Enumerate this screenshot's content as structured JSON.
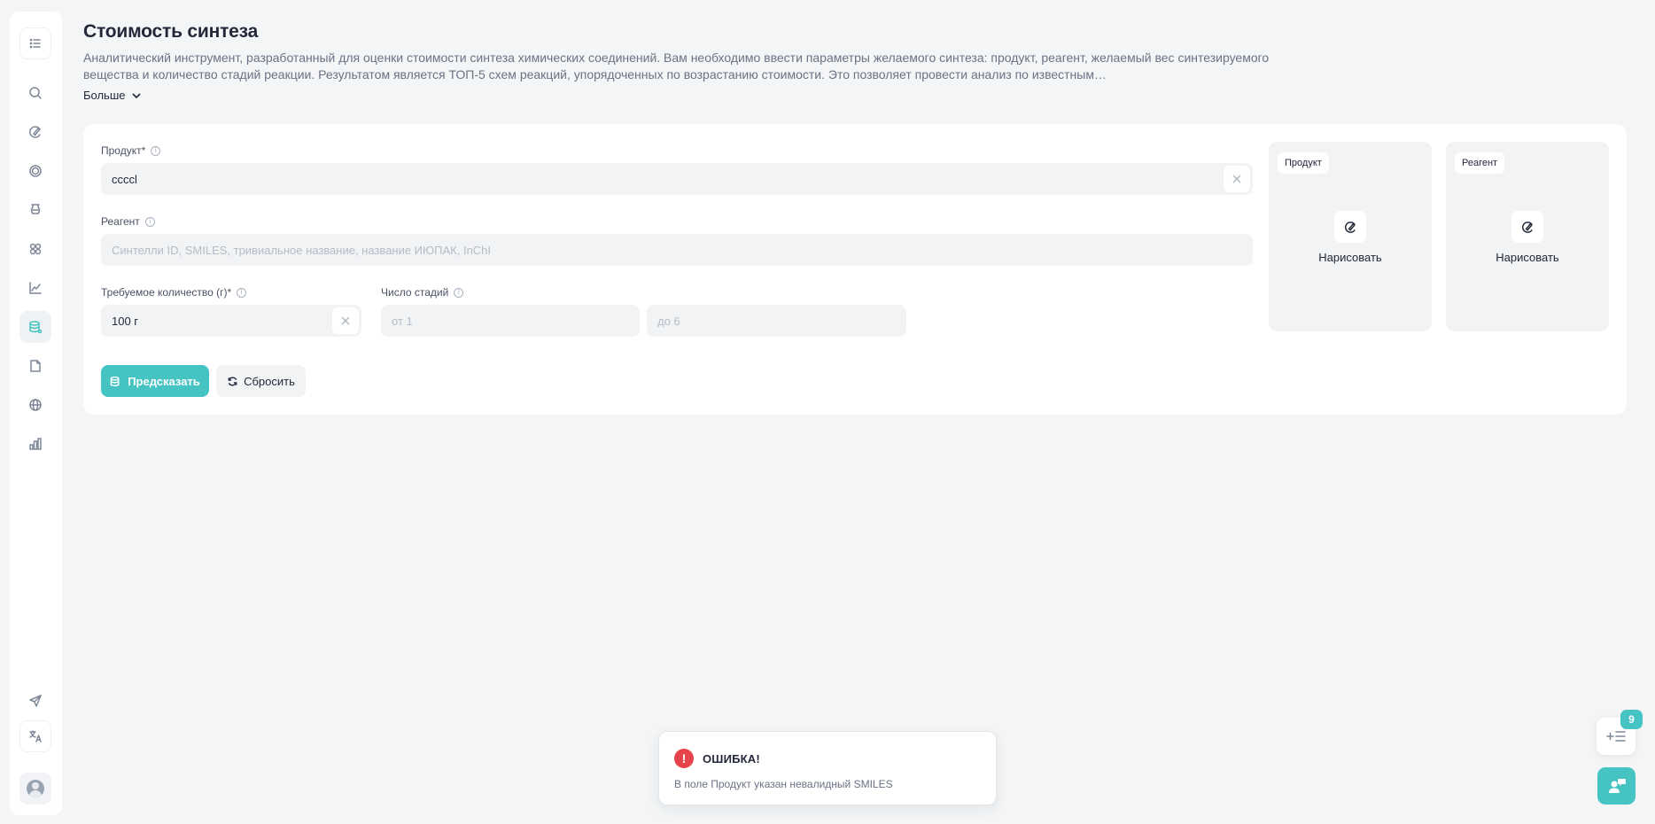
{
  "app": {
    "accent_color": "#46c3c3",
    "error_color": "#e5454a"
  },
  "sidebar": {
    "items": [
      {
        "name": "menu-list-icon"
      },
      {
        "name": "search-icon"
      },
      {
        "name": "draw-molecule-icon"
      },
      {
        "name": "target-icon"
      },
      {
        "name": "flask-icon"
      },
      {
        "name": "molecule-network-icon"
      },
      {
        "name": "line-chart-icon"
      },
      {
        "name": "synthesis-cost-icon",
        "active": true
      },
      {
        "name": "document-icon"
      },
      {
        "name": "globe-icon"
      },
      {
        "name": "bar-chart-icon"
      },
      {
        "name": "send-icon"
      },
      {
        "name": "translate-icon"
      },
      {
        "name": "avatar"
      }
    ]
  },
  "header": {
    "title": "Стоимость синтеза",
    "description": "Аналитический инструмент, разработанный для оценки стоимости синтеза химических соединений. Вам необходимо ввести параметры желаемого синтеза: продукт, реагент, желаемый вес синтезируемого вещества и количество стадий реакции. Результатом является ТОП-5 схем реакций, упорядоченных по возрастанию стоимости. Это позволяет провести анализ по известным…",
    "more_label": "Больше"
  },
  "form": {
    "product": {
      "label": "Продукт*",
      "value": "ccccl"
    },
    "reagent": {
      "label": "Реагент",
      "placeholder": "Синтелли ID, SMILES, тривиальное название, название ИЮПАК, InChI"
    },
    "amount": {
      "label": "Требуемое количество (г)*",
      "value": "100 г"
    },
    "stages": {
      "label": "Число стадий",
      "from_placeholder": "от 1",
      "to_placeholder": "до 6"
    },
    "predict_label": "Предсказать",
    "reset_label": "Сбросить"
  },
  "panels": {
    "product": {
      "tag": "Продукт",
      "draw_label": "Нарисовать"
    },
    "reagent": {
      "tag": "Реагент",
      "draw_label": "Нарисовать"
    }
  },
  "toast": {
    "icon": "!",
    "title": "ОШИБКА!",
    "message": "В поле Продукт указан невалидный SMILES"
  },
  "floating": {
    "badge_count": "9"
  }
}
